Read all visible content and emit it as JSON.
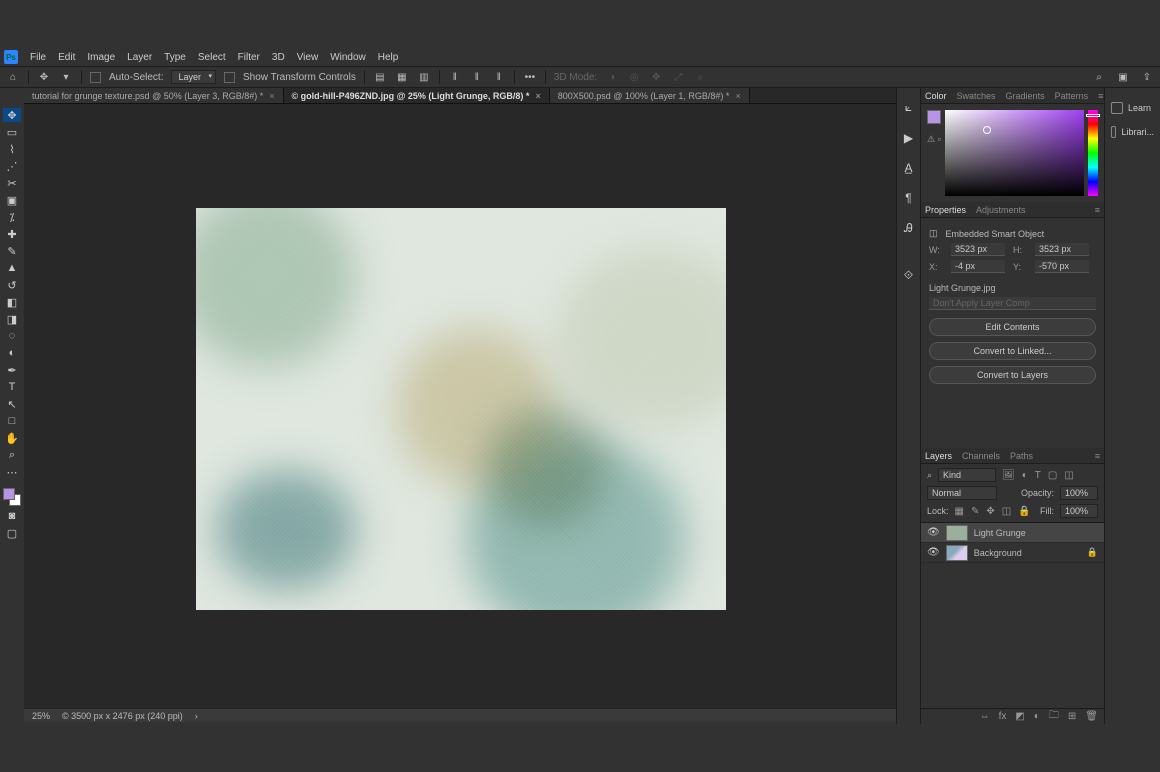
{
  "menu": [
    "File",
    "Edit",
    "Image",
    "Layer",
    "Type",
    "Select",
    "Filter",
    "3D",
    "View",
    "Window",
    "Help"
  ],
  "options": {
    "auto_select": "Auto-Select:",
    "layer_dropdown": "Layer",
    "show_transform": "Show Transform Controls",
    "mode": "3D Mode:"
  },
  "tabs": [
    {
      "title": "tutorial for grunge texture.psd @ 50% (Layer 3, RGB/8#) *",
      "active": false
    },
    {
      "title": "© gold-hill-P496ZND.jpg @ 25% (Light Grunge, RGB/8) *",
      "active": true
    },
    {
      "title": "800X500.psd @ 100% (Layer 1, RGB/8#) *",
      "active": false
    }
  ],
  "status": {
    "zoom": "25%",
    "doc": "© 3500 px x 2476 px (240 ppi)",
    "arrow": "›"
  },
  "color_tabs": [
    "Color",
    "Swatches",
    "Gradients",
    "Patterns"
  ],
  "props_tabs": [
    "Properties",
    "Adjustments"
  ],
  "layers_tabs": [
    "Layers",
    "Channels",
    "Paths"
  ],
  "far_right": {
    "learn": "Learn",
    "libraries": "Librari..."
  },
  "properties": {
    "title": "Embedded Smart Object",
    "w_label": "W:",
    "w": "3523 px",
    "h_label": "H:",
    "h": "3523 px",
    "x_label": "X:",
    "x": "-4 px",
    "y_label": "Y:",
    "y": "-570 px",
    "filename": "Light Grunge.jpg",
    "layercomp": "Don't Apply Layer Comp",
    "btn1": "Edit Contents",
    "btn2": "Convert to Linked...",
    "btn3": "Convert to Layers"
  },
  "layers": {
    "kind_label": "Kind",
    "blend": "Normal",
    "opacity_label": "Opacity:",
    "opacity": "100%",
    "lock_label": "Lock:",
    "fill_label": "Fill:",
    "fill": "100%",
    "items": [
      {
        "name": "Light Grunge",
        "sel": true,
        "locked": false
      },
      {
        "name": "Background",
        "sel": false,
        "locked": true
      }
    ]
  }
}
